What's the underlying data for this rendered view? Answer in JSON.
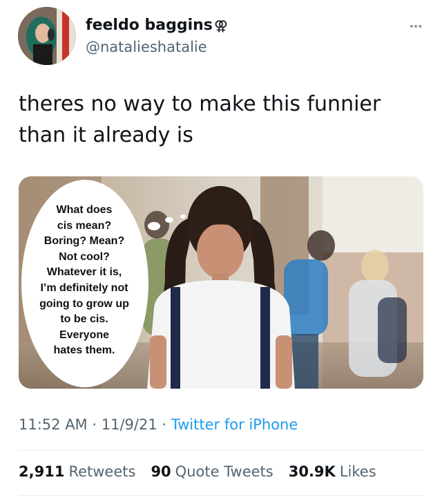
{
  "author": {
    "display_name": "feeldo baggins",
    "name_symbol": "⚢",
    "handle": "@natalieshatalie"
  },
  "more_menu": "•••",
  "tweet_text": "theres no way to make this funnier than it already is",
  "image": {
    "bubble_lines": [
      "What does",
      "cis mean?",
      "Boring? Mean?",
      "Not cool?",
      "Whatever it is,",
      "I’m definitely not",
      "going to grow up",
      "to be cis.",
      "Everyone",
      "hates them."
    ]
  },
  "meta": {
    "time": "11:52 AM",
    "date": "11/9/21",
    "separator": "·",
    "source": "Twitter for iPhone"
  },
  "stats": {
    "retweets_count": "2,911",
    "retweets_label": "Retweets",
    "quotes_count": "90",
    "quotes_label": "Quote Tweets",
    "likes_count": "30.9K",
    "likes_label": "Likes"
  },
  "colors": {
    "link": "#1d9bf0",
    "muted": "#536471",
    "text": "#0f1419"
  }
}
